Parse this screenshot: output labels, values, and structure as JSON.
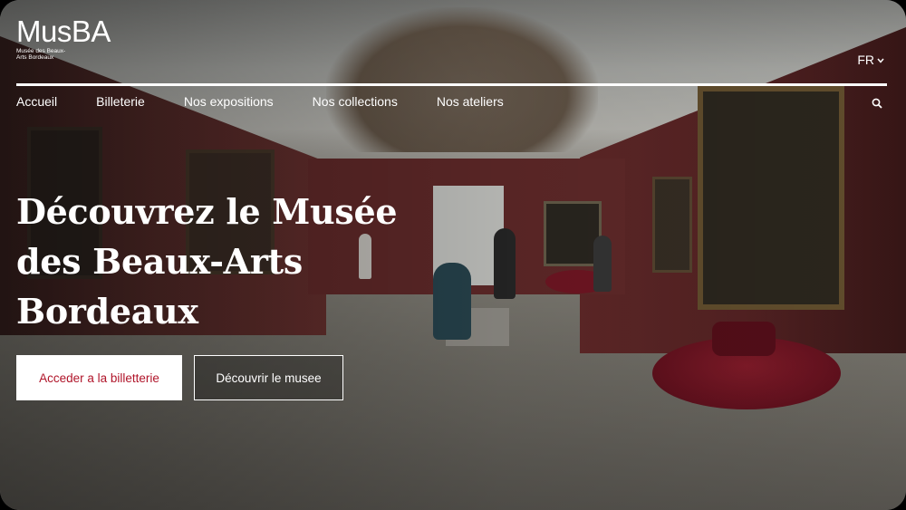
{
  "logo": {
    "wordmark": "MusBA",
    "subtitle": "Musée des Beaux-Arts Bordeaux"
  },
  "language": {
    "selected": "FR",
    "icon": "chevron-down-icon"
  },
  "nav": {
    "items": [
      {
        "label": "Accueil"
      },
      {
        "label": "Billeterie"
      },
      {
        "label": "Nos expositions"
      },
      {
        "label": "Nos collections"
      },
      {
        "label": "Nos ateliers"
      }
    ],
    "search_icon": "search-icon"
  },
  "hero": {
    "title": "Découvrez le Musée des Beaux-Arts Bordeaux",
    "primary_button": "Acceder a la billetterie",
    "secondary_button": "Découvrir le musee"
  },
  "colors": {
    "accent": "#b0152a",
    "white": "#ffffff"
  }
}
